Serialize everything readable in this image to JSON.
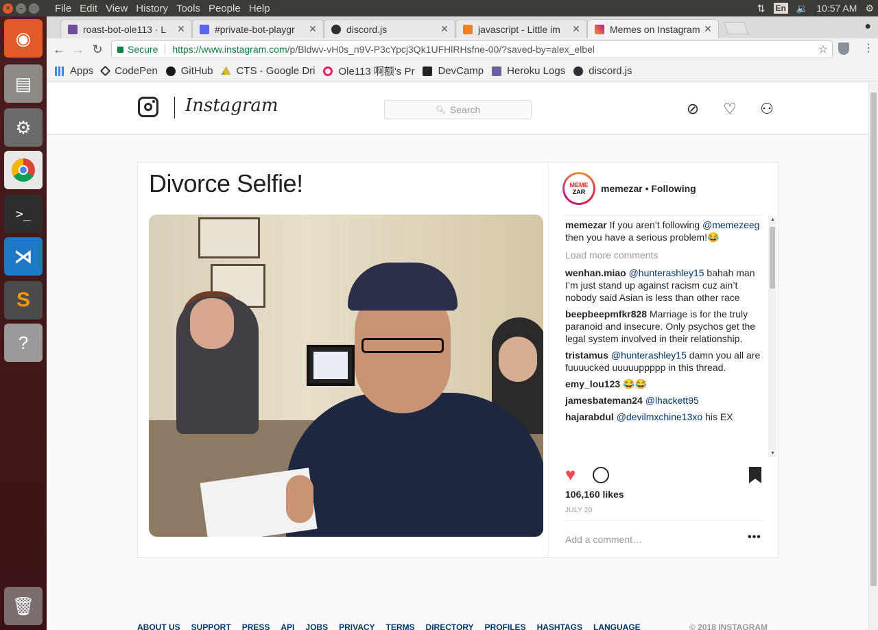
{
  "os": {
    "menus": [
      "File",
      "Edit",
      "View",
      "History",
      "Tools",
      "People",
      "Help"
    ],
    "lang": "En",
    "time": "10:57 AM"
  },
  "tabs": [
    {
      "title": "roast-bot-ole113 · L",
      "color": "#6f4e9b"
    },
    {
      "title": "#private-bot-playgr",
      "color": "#5865f2"
    },
    {
      "title": "discord.js",
      "color": "#2c2f33"
    },
    {
      "title": "javascript - Little im",
      "color": "#f48024"
    },
    {
      "title": "Memes on Instagram",
      "color": "#c13584"
    }
  ],
  "address": {
    "secure_label": "Secure",
    "url_host": "https://www.instagram.com",
    "url_path": "/p/Bldwv-vH0s_n9V-P3cYpcj3Qk1UFHlRHsfne-00/?saved-by=alex_elbel"
  },
  "bookmarks": [
    {
      "label": "Apps",
      "color": "#4285f4"
    },
    {
      "label": "CodePen",
      "color": "#333333"
    },
    {
      "label": "GitHub",
      "color": "#181717"
    },
    {
      "label": "CTS - Google Dri",
      "color": "#fbbc05"
    },
    {
      "label": "Ole113 啊额's Pr",
      "color": "#e91e63"
    },
    {
      "label": "DevCamp",
      "color": "#222222"
    },
    {
      "label": "Heroku Logs",
      "color": "#6762a6"
    },
    {
      "label": "discord.js",
      "color": "#2c2f33"
    }
  ],
  "instagram": {
    "wordmark": "Instagram",
    "search_placeholder": "Search"
  },
  "post": {
    "meme_title": "Divorce Selfie!",
    "avatar_line1": "MEME",
    "avatar_line2": "ZAR",
    "header": "memezar • Following",
    "caption": {
      "user": "memezar",
      "text_before": " If you aren’t following ",
      "mention": "@memezeeg",
      "text_after": " then you have a serious problem!😂"
    },
    "load_more": "Load more comments",
    "comments": [
      {
        "user": "wenhan.miao",
        "mention": "@hunterashley15",
        "text": " bahah man I’m just stand up against racism cuz ain’t nobody said Asian is less than other race"
      },
      {
        "user": "beepbeepmfkr828",
        "mention": "",
        "text": " Marriage is for the truly paranoid and insecure. Only psychos get the legal system involved in their relationship."
      },
      {
        "user": "tristamus",
        "mention": "@hunterashley15",
        "text": " damn you all are fuuuucked uuuuuppppp in this thread."
      },
      {
        "user": "emy_lou123",
        "mention": "",
        "text": " 😂😂"
      },
      {
        "user": "jamesbateman24",
        "mention": "@lhackett95",
        "text": ""
      },
      {
        "user": "hajarabdul",
        "mention": "@devilmxchine13xo",
        "text": " his EX"
      }
    ],
    "likes": "106,160 likes",
    "date": "JULY 20",
    "add_comment": "Add a comment…",
    "more": "•••"
  },
  "footer": {
    "links": [
      "ABOUT US",
      "SUPPORT",
      "PRESS",
      "API",
      "JOBS",
      "PRIVACY",
      "TERMS",
      "DIRECTORY",
      "PROFILES",
      "HASHTAGS",
      "LANGUAGE"
    ],
    "copyright": "© 2018 INSTAGRAM"
  }
}
